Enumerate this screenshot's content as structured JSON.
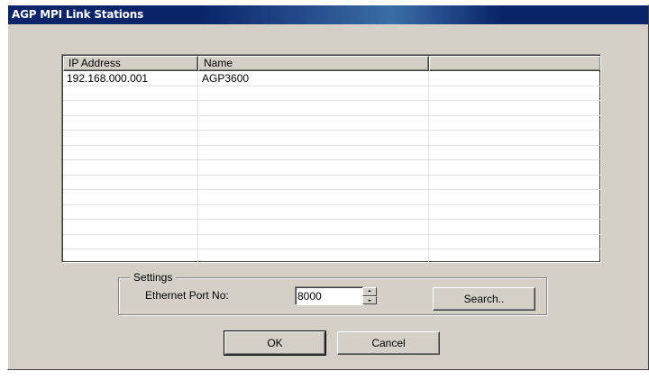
{
  "window": {
    "title": "AGP MPI Link Stations"
  },
  "list": {
    "columns": [
      "IP Address",
      "Name",
      ""
    ],
    "rows": [
      [
        "192.168.000.001",
        "AGP3600",
        ""
      ],
      [
        "",
        "",
        ""
      ],
      [
        "",
        "",
        ""
      ],
      [
        "",
        "",
        ""
      ],
      [
        "",
        "",
        ""
      ],
      [
        "",
        "",
        ""
      ],
      [
        "",
        "",
        ""
      ],
      [
        "",
        "",
        ""
      ],
      [
        "",
        "",
        ""
      ],
      [
        "",
        "",
        ""
      ],
      [
        "",
        "",
        ""
      ],
      [
        "",
        "",
        ""
      ],
      [
        "",
        "",
        ""
      ]
    ]
  },
  "settings": {
    "group_label": "Settings",
    "port_label": "Ethernet Port No:",
    "port_value": "8000",
    "search_label": "Search.."
  },
  "actions": {
    "ok_label": "OK",
    "cancel_label": "Cancel"
  },
  "colors": {
    "face": "#d4d0c8",
    "title_active": "#0a246a",
    "title_text": "#ffffff"
  }
}
